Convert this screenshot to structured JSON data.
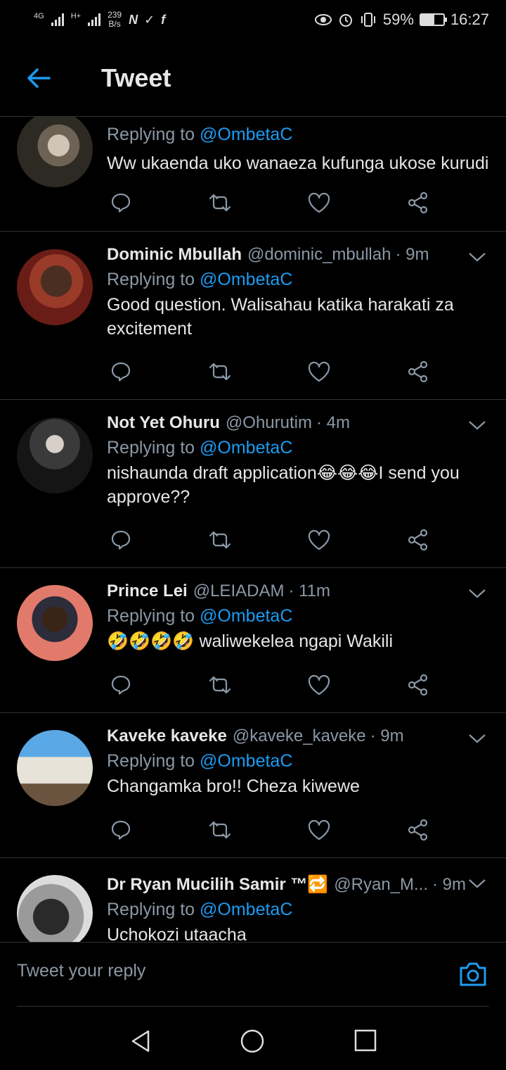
{
  "status_bar": {
    "network": "4G",
    "network2": "H+",
    "speed_value": "239",
    "speed_unit": "B/s",
    "app_icons": "N ✓ f",
    "battery": "59%",
    "time": "16:27"
  },
  "header": {
    "title": "Tweet"
  },
  "tweets": [
    {
      "name": "",
      "handle": "",
      "time": "",
      "replying_prefix": "Replying to ",
      "replying_handle": "@OmbetaC",
      "text": "Ww ukaenda uko wanaeza kufunga ukose kurudi"
    },
    {
      "name": "Dominic Mbullah",
      "handle": "@dominic_mbullah",
      "time": "· 9m",
      "replying_prefix": "Replying to ",
      "replying_handle": "@OmbetaC",
      "text": "Good question. Walisahau katika harakati za excitement"
    },
    {
      "name": "Not Yet Ohuru",
      "handle": "@Ohurutim",
      "time": "· 4m",
      "replying_prefix": "Replying to ",
      "replying_handle": "@OmbetaC",
      "text": "nishaunda draft application😂😂😂I send you approve??"
    },
    {
      "name": "Prince Lei",
      "handle": "@LEIADAM",
      "time": "· 11m",
      "replying_prefix": "Replying to ",
      "replying_handle": "@OmbetaC",
      "text": "🤣🤣🤣🤣 waliwekelea ngapi Wakili"
    },
    {
      "name": "Kaveke kaveke",
      "handle": "@kaveke_kaveke",
      "time": "· 9m",
      "replying_prefix": "Replying to ",
      "replying_handle": "@OmbetaC",
      "text": "Changamka bro!! Cheza kiwewe"
    },
    {
      "name": "Dr Ryan Mucilih Samir ™🔁",
      "handle": "@Ryan_M...",
      "time": "· 9m",
      "replying_prefix": "Replying to ",
      "replying_handle": "@OmbetaC",
      "text": "Uchokozi utaacha"
    }
  ],
  "reply_bar": {
    "placeholder": "Tweet your reply"
  },
  "colors": {
    "accent": "#1d9bf0",
    "background": "#000000",
    "muted": "#8b98a5",
    "divider": "#2f3336"
  },
  "icons": [
    "back-arrow-icon",
    "reply-icon",
    "retweet-icon",
    "like-icon",
    "share-icon",
    "chevron-down-icon",
    "camera-icon",
    "nav-back-icon",
    "nav-home-icon",
    "nav-recents-icon"
  ]
}
